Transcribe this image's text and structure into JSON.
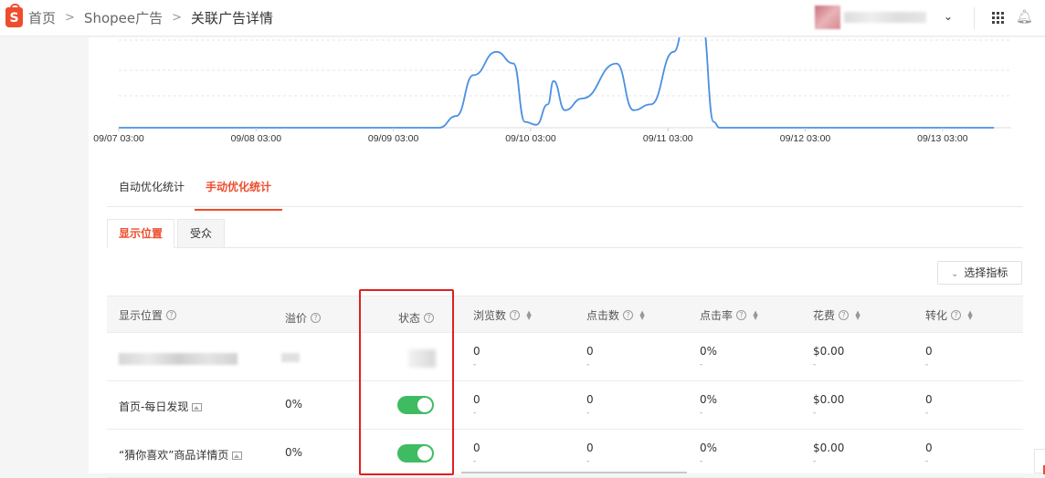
{
  "breadcrumb": {
    "home": "首页",
    "section": "Shopee广告",
    "current": "关联广告详情"
  },
  "colors": {
    "accent": "#ee4d2d",
    "line": "#4a90e2",
    "toggle_on": "#3fbc62",
    "highlight_box": "#e02020"
  },
  "chart_data": {
    "type": "line",
    "x_tick_labels": [
      "09/07 03:00",
      "09/08 03:00",
      "09/09 03:00",
      "09/10 03:00",
      "09/11 03:00",
      "09/12 03:00",
      "09/13 03:00"
    ],
    "grid": "horizontal dashed",
    "series": [
      {
        "points": [
          [
            "09/07 03:00",
            0
          ],
          [
            "09/09 03:00",
            0
          ],
          [
            "09/09 11:00",
            0
          ],
          [
            "09/09 14:00",
            0.4
          ],
          [
            "09/09 17:00",
            1.8
          ],
          [
            "09/09 21:00",
            2.6
          ],
          [
            "09/10 00:00",
            2.2
          ],
          [
            "09/10 02:00",
            0.2
          ],
          [
            "09/10 04:00",
            0.1
          ],
          [
            "09/10 06:00",
            0.8
          ],
          [
            "09/10 07:00",
            1.6
          ],
          [
            "09/10 09:00",
            0.6
          ],
          [
            "09/10 12:00",
            1.0
          ],
          [
            "09/10 18:00",
            2.2
          ],
          [
            "09/10 21:00",
            0.6
          ],
          [
            "09/11 00:00",
            0.8
          ],
          [
            "09/11 04:00",
            2.6
          ],
          [
            "09/11 06:00",
            3.6
          ],
          [
            "09/11 09:00",
            3.6
          ],
          [
            "09/11 11:00",
            0.2
          ],
          [
            "09/11 12:00",
            0
          ],
          [
            "09/13 12:00",
            0
          ]
        ]
      }
    ]
  },
  "stat_tabs": {
    "auto": "自动优化统计",
    "manual": "手动优化统计"
  },
  "sub_tabs": {
    "placement": "显示位置",
    "audience": "受众"
  },
  "select_metrics_label": "选择指标",
  "table": {
    "headers": {
      "placement": "显示位置",
      "premium": "溢价",
      "status": "状态",
      "views": "浏览数",
      "clicks": "点击数",
      "ctr": "点击率",
      "spend": "花费",
      "conversions": "转化"
    },
    "rows": [
      {
        "placement": "",
        "premium": "",
        "views": "0",
        "clicks": "0",
        "ctr": "0%",
        "spend": "$0.00",
        "conversions": "0",
        "sub": "-"
      },
      {
        "placement": "首页-每日发现",
        "premium": "0%",
        "status_on": true,
        "views": "0",
        "clicks": "0",
        "ctr": "0%",
        "spend": "$0.00",
        "conversions": "0",
        "sub": "-"
      },
      {
        "placement": "“猜你喜欢”商品详情页",
        "premium": "0%",
        "status_on": true,
        "views": "0",
        "clicks": "0",
        "ctr": "0%",
        "spend": "$0.00",
        "conversions": "0",
        "sub": "-"
      }
    ]
  }
}
